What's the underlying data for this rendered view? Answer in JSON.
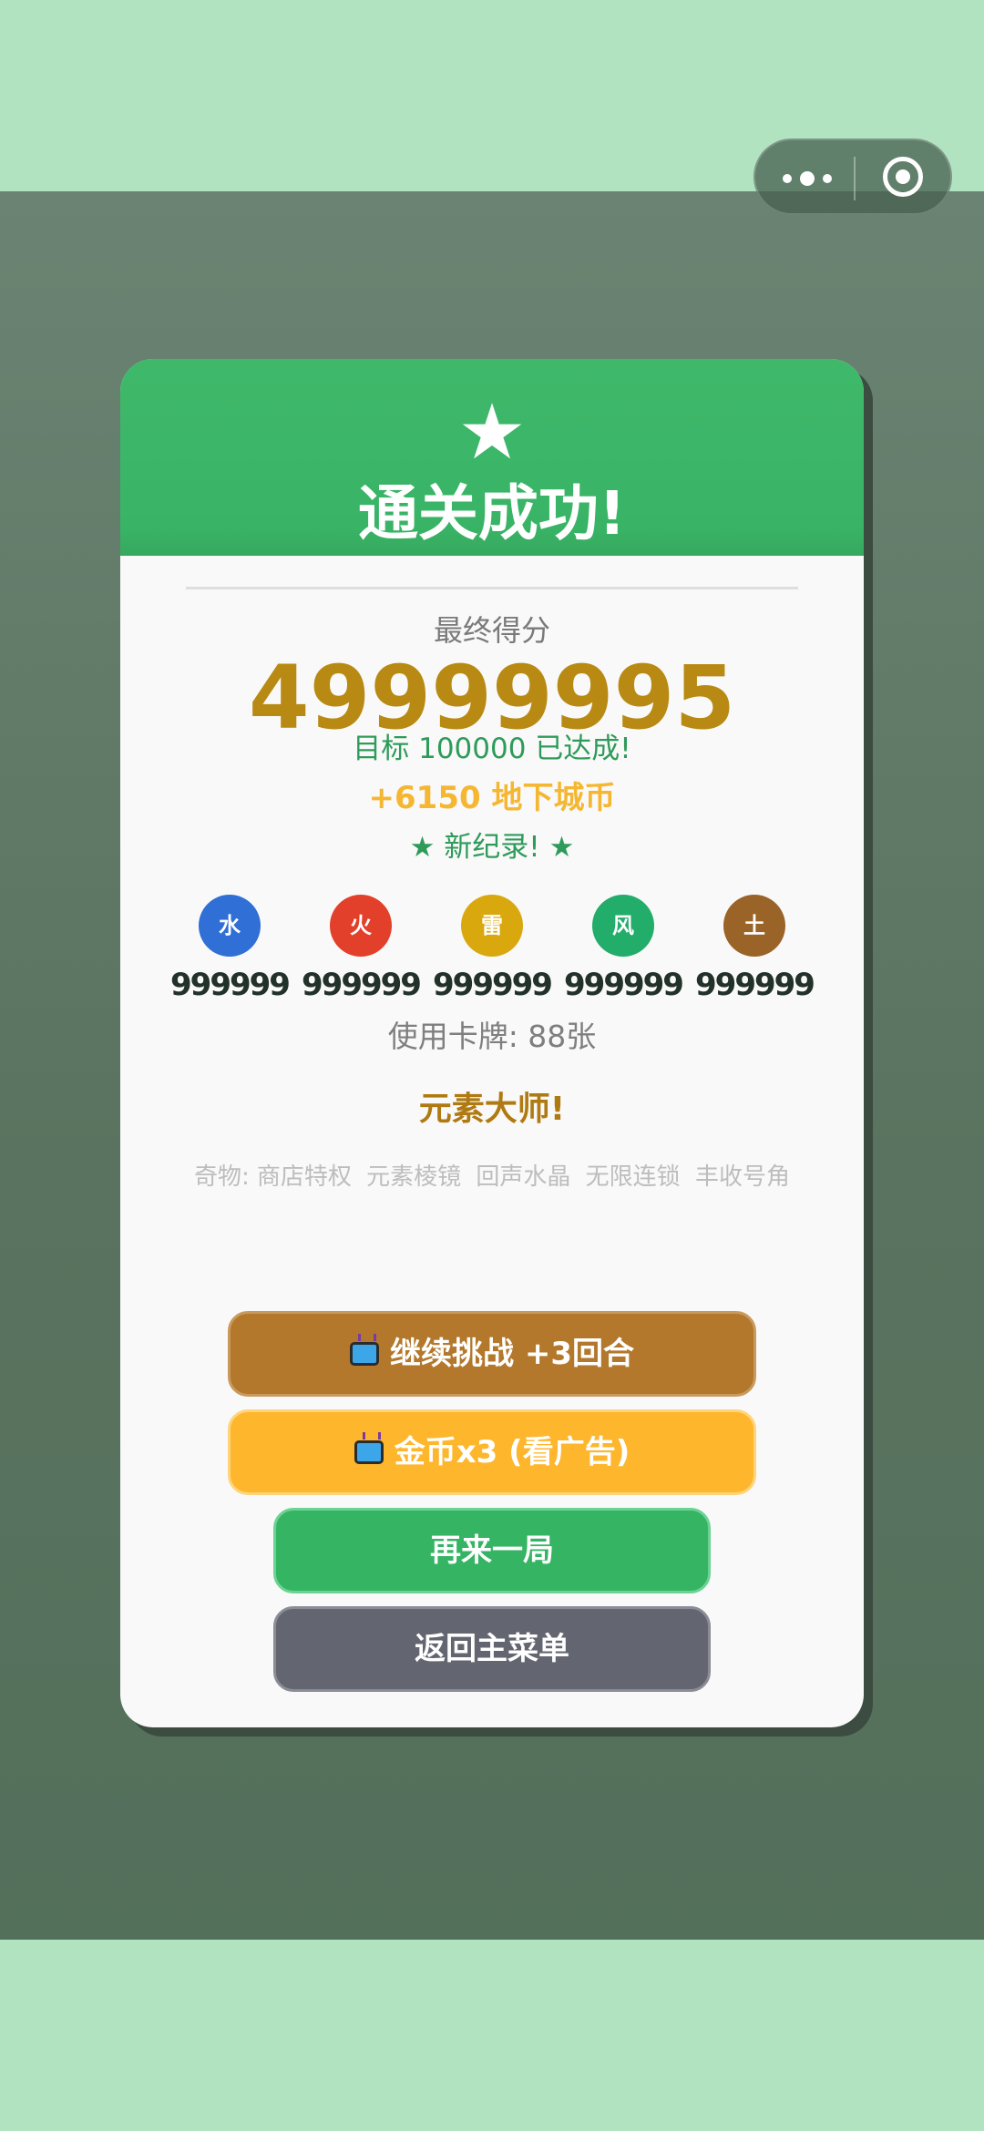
{
  "header": {
    "star_icon": "★",
    "title": "通关成功!"
  },
  "result": {
    "score_label": "最终得分",
    "score_value": "49999995",
    "target_text": "目标 100000 已达成!",
    "coins_text": "+6150 地下城币",
    "record_text": "★ 新纪录! ★"
  },
  "elements": [
    {
      "label": "水",
      "count": "999999",
      "color": "#2f6fd6"
    },
    {
      "label": "火",
      "count": "999999",
      "color": "#e2402a"
    },
    {
      "label": "雷",
      "count": "999999",
      "color": "#d9a80f"
    },
    {
      "label": "风",
      "count": "999999",
      "color": "#22ad6a"
    },
    {
      "label": "土",
      "count": "999999",
      "color": "#9a6328"
    }
  ],
  "cards_used": "使用卡牌: 88张",
  "master_title": "元素大师!",
  "relics": {
    "prefix": "奇物:",
    "items": [
      "商店特权",
      "元素棱镜",
      "回声水晶",
      "无限连锁",
      "丰收号角"
    ]
  },
  "buttons": {
    "continue_label": "继续挑战 +3回合",
    "coins_label": "金币x3 (看广告)",
    "again_label": "再来一局",
    "menu_label": "返回主菜单"
  },
  "colors": {
    "header_green": "#3fb86a",
    "score_gold": "#b88a14",
    "continue_brown": "#b3782c",
    "coins_orange": "#feb62d",
    "again_green": "#35b463",
    "menu_gray": "#636570"
  }
}
